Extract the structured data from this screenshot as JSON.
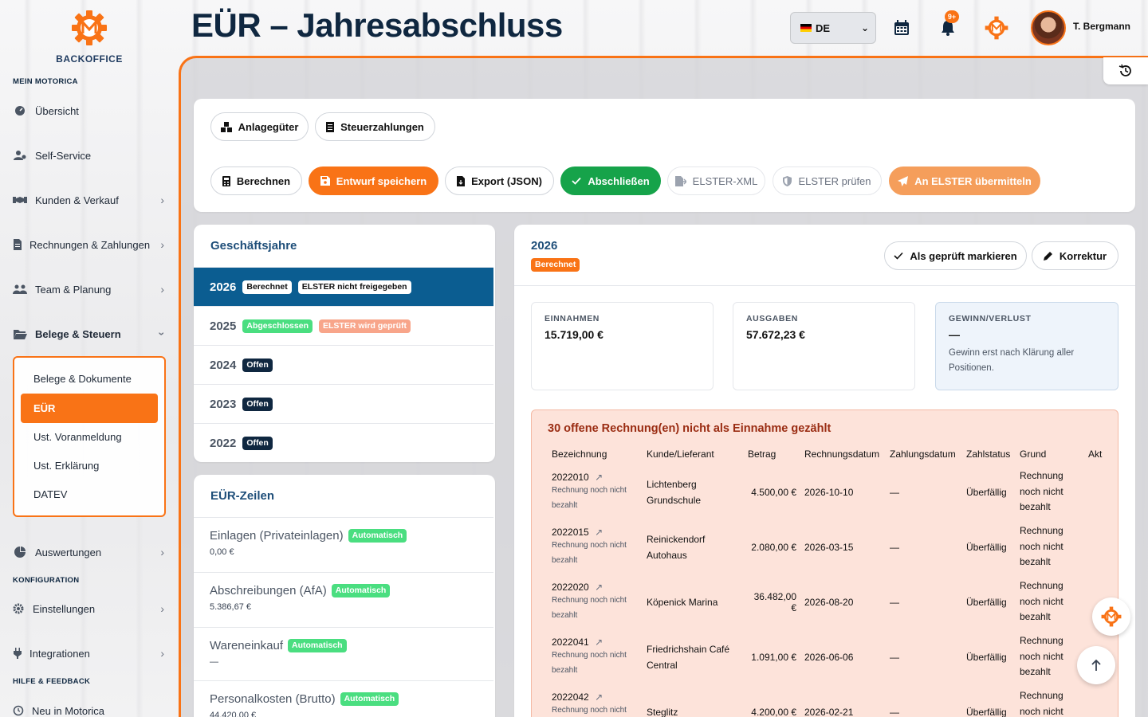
{
  "brand": {
    "name": "BACKOFFICE",
    "accent": "#f97316",
    "primary": "#0f2740"
  },
  "sidebar": {
    "sections": {
      "mein": "MEIN MOTORICA",
      "konfig": "KONFIGURATION",
      "hilfe": "HILFE & FEEDBACK"
    },
    "items": {
      "uebersicht": "Übersicht",
      "selfservice": "Self-Service",
      "kunden": "Kunden & Verkauf",
      "rechnungen": "Rechnungen & Zahlungen",
      "team": "Team & Planung",
      "belege": "Belege & Steuern",
      "auswertungen": "Auswertungen",
      "einstellungen": "Einstellungen",
      "integrationen": "Integrationen",
      "neu": "Neu in Motorica"
    },
    "submenu": {
      "dokumente": "Belege & Dokumente",
      "eur": "EÜR",
      "voranmeldung": "Ust. Voranmeldung",
      "erklaerung": "Ust. Erklärung",
      "datev": "DATEV"
    }
  },
  "header": {
    "title": "EÜR – Jahresabschluss",
    "language": "DE",
    "notif_badge": "9+",
    "user": "T. Bergmann"
  },
  "toolbar": {
    "anlagegueter": "Anlagegüter",
    "steuerzahlungen": "Steuerzahlungen",
    "berechnen": "Berechnen",
    "entwurf": "Entwurf speichern",
    "export": "Export (JSON)",
    "abschliessen": "Abschließen",
    "elster_xml": "ELSTER-XML",
    "elster_pruefen": "ELSTER prüfen",
    "elster_senden": "An ELSTER übermitteln"
  },
  "geschaeftsjahre": {
    "title": "Geschäftsjahre",
    "years": [
      {
        "year": "2026",
        "badges": [
          "Berechnet",
          "ELSTER nicht freigegeben"
        ]
      },
      {
        "year": "2025",
        "badges": [
          "Abgeschlossen",
          "ELSTER wird geprüft"
        ]
      },
      {
        "year": "2024",
        "badges": [
          "Offen"
        ]
      },
      {
        "year": "2023",
        "badges": [
          "Offen"
        ]
      },
      {
        "year": "2022",
        "badges": [
          "Offen"
        ]
      }
    ]
  },
  "eur_zeilen": {
    "title": "EÜR-Zeilen",
    "rows": [
      {
        "label": "Einlagen (Privateinlagen)",
        "badge": "Automatisch",
        "value": "0,00 €"
      },
      {
        "label": "Abschreibungen (AfA)",
        "badge": "Automatisch",
        "value": "5.386,67 €"
      },
      {
        "label": "Wareneinkauf",
        "badge": "Automatisch",
        "value": "—"
      },
      {
        "label": "Personalkosten (Brutto)",
        "badge": "Automatisch",
        "value": "44.420,00 €"
      }
    ]
  },
  "detail": {
    "year": "2026",
    "status": "Berechnet",
    "btn_geprueft": "Als geprüft markieren",
    "btn_korrektur": "Korrektur",
    "stats": {
      "einnahmen_label": "EINNAHMEN",
      "einnahmen_value": "15.719,00 €",
      "ausgaben_label": "AUSGABEN",
      "ausgaben_value": "57.672,23 €",
      "gewinn_label": "GEWINN/VERLUST",
      "gewinn_value": "—",
      "gewinn_note": "Gewinn erst nach Klärung aller Positionen."
    }
  },
  "open_invoices": {
    "title": "30 offene Rechnung(en) nicht als Einnahme gezählt",
    "columns": [
      "Bezeichnung",
      "Kunde/Lieferant",
      "Betrag",
      "Rechnungsdatum",
      "Zahlungsdatum",
      "Zahlstatus",
      "Grund",
      "Akt"
    ],
    "rows": [
      {
        "nr": "2022010",
        "sub": "Rechnung noch nicht bezahlt",
        "kunde": "Lichtenberg Grundschule",
        "betrag": "4.500,00 €",
        "datum": "2026-10-10",
        "zahldatum": "—",
        "status": "Überfällig",
        "grund": "Rechnung noch nicht bezahlt"
      },
      {
        "nr": "2022015",
        "sub": "Rechnung noch nicht bezahlt",
        "kunde": "Reinickendorf Autohaus",
        "betrag": "2.080,00 €",
        "datum": "2026-03-15",
        "zahldatum": "—",
        "status": "Überfällig",
        "grund": "Rechnung noch nicht bezahlt"
      },
      {
        "nr": "2022020",
        "sub": "Rechnung noch nicht bezahlt",
        "kunde": "Köpenick Marina",
        "betrag": "36.482,00 €",
        "datum": "2026-08-20",
        "zahldatum": "—",
        "status": "Überfällig",
        "grund": "Rechnung noch nicht bezahlt"
      },
      {
        "nr": "2022041",
        "sub": "Rechnung noch nicht bezahlt",
        "kunde": "Friedrichshain Café Central",
        "betrag": "1.091,00 €",
        "datum": "2026-06-06",
        "zahldatum": "—",
        "status": "Überfällig",
        "grund": "Rechnung noch nicht bezahlt"
      },
      {
        "nr": "2022042",
        "sub": "Rechnung noch nicht bezahlt",
        "kunde": "Steglitz",
        "betrag": "4.200,00 €",
        "datum": "2026-02-21",
        "zahldatum": "—",
        "status": "Überfällig",
        "grund": "Rechnung noch nicht bezahlt"
      }
    ]
  }
}
